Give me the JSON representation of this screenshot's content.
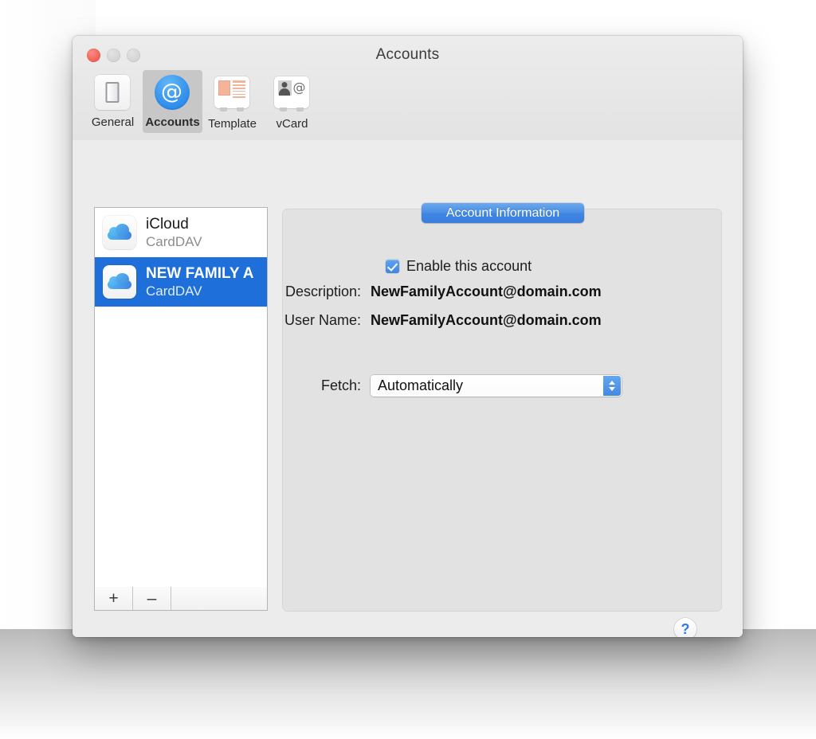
{
  "window": {
    "title": "Accounts",
    "traffic_lights": [
      {
        "name": "close",
        "color": "#f2645a"
      },
      {
        "name": "minimize",
        "color": "#d6d6d6"
      },
      {
        "name": "zoom",
        "color": "#d6d6d6"
      }
    ]
  },
  "toolbar": {
    "items": [
      {
        "label": "General",
        "icon": "contact-card-icon",
        "selected": false
      },
      {
        "label": "Accounts",
        "icon": "at-sign-circle-icon",
        "selected": true
      },
      {
        "label": "Template",
        "icon": "template-card-icon",
        "selected": false
      },
      {
        "label": "vCard",
        "icon": "vcard-person-at-icon",
        "selected": false
      }
    ]
  },
  "accounts": {
    "rows": [
      {
        "name": "iCloud",
        "type": "CardDAV",
        "icon": "icloud-cloud-icon",
        "selected": false
      },
      {
        "name": "NEW FAMILY A",
        "type": "CardDAV",
        "icon": "icloud-cloud-icon",
        "selected": true
      }
    ],
    "add_label": "+",
    "remove_label": "–"
  },
  "detail": {
    "pane_tab_label": "Account Information",
    "enable_checkbox": {
      "label": "Enable this account",
      "checked": true
    },
    "fields": [
      {
        "label": "Description:",
        "value": "NewFamilyAccount@domain.com"
      },
      {
        "label": "User Name:",
        "value": "NewFamilyAccount@domain.com"
      }
    ],
    "fetch": {
      "label": "Fetch:",
      "value": "Automatically"
    }
  },
  "help": {
    "label": "?"
  },
  "colors": {
    "accent_blue": "#3f86e2",
    "selection_blue": "#1e6fd9",
    "window_bg": "#ececec",
    "detail_bg": "#e2e2e2",
    "help_blue": "#2d7bf0"
  }
}
